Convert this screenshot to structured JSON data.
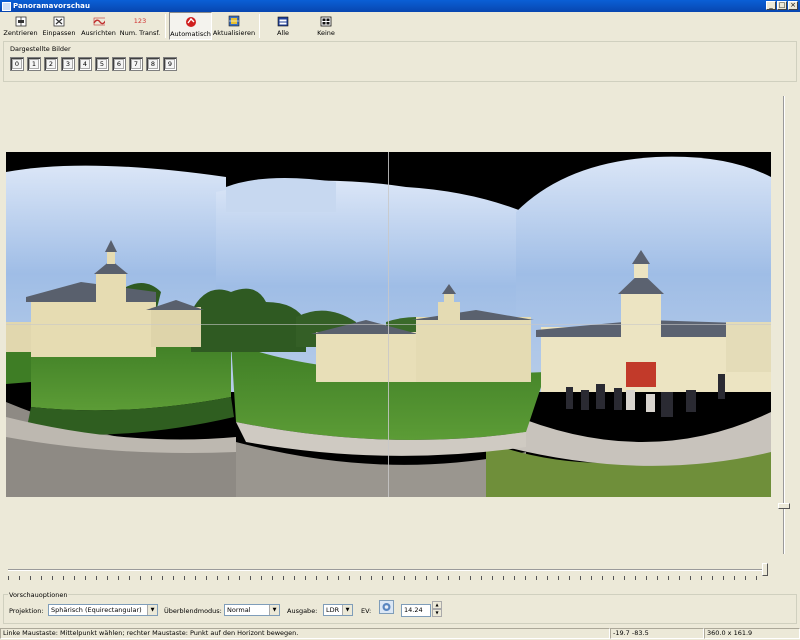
{
  "window": {
    "title": "Panoramavorschau",
    "buttons": {
      "minimize": "_",
      "maximize": "□",
      "close": "×"
    }
  },
  "toolbar": {
    "items": [
      {
        "label": "Zentrieren",
        "icon": "center-icon"
      },
      {
        "label": "Einpassen",
        "icon": "fit-icon"
      },
      {
        "label": "Ausrichten",
        "icon": "straighten-icon"
      },
      {
        "label": "Num. Transf.",
        "icon": "numeric-transform-icon",
        "icon_text": "123"
      },
      {
        "label": "Automatisch",
        "icon": "auto-refresh-icon",
        "active": true
      },
      {
        "label": "Aktualisieren",
        "icon": "update-icon"
      },
      {
        "label": "Alle",
        "icon": "all-images-icon"
      },
      {
        "label": "Keine",
        "icon": "no-images-icon"
      }
    ]
  },
  "displayed_images": {
    "legend": "Dargestellte Bilder",
    "items": [
      "0",
      "1",
      "2",
      "3",
      "4",
      "5",
      "6",
      "7",
      "8",
      "9"
    ]
  },
  "preview_options": {
    "legend": "Vorschauoptionen",
    "projection_label": "Projektion:",
    "projection_value": "Sphärisch (Equirectangular)",
    "blend_label": "Überblendmodus:",
    "blend_value": "Normal",
    "output_label": "Ausgabe:",
    "output_value": "LDR",
    "ev_label": "EV:",
    "ev_value": "14.24"
  },
  "status": {
    "hint": "Linke Maustaste: Mittelpunkt wählen; rechter Maustaste: Punkt auf den Horizont bewegen.",
    "coords": "-19.7 -83.5",
    "fov": "360.0 x 161.9"
  },
  "colors": {
    "titlebar": "#0a5fd6",
    "window_bg": "#ece9d8",
    "sky": "#9fbde6",
    "grass": "#4f8f2f",
    "building": "#e4dcb4",
    "roof": "#5c6270"
  }
}
